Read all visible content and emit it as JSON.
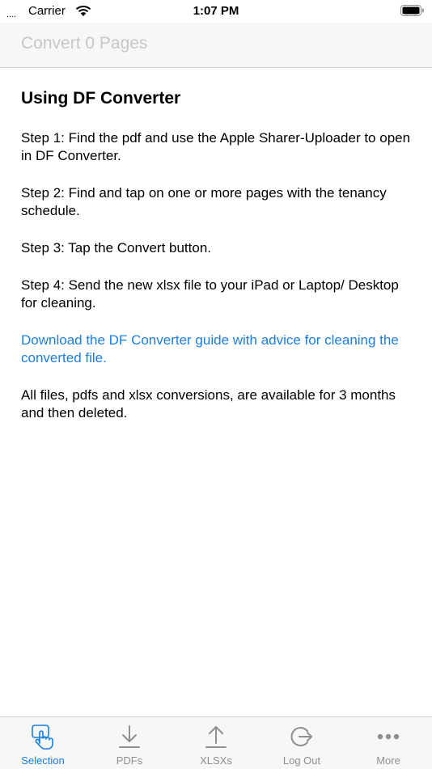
{
  "status_bar": {
    "signal": "....",
    "carrier": "Carrier",
    "time": "1:07 PM"
  },
  "nav": {
    "convert_label": "Convert 0 Pages"
  },
  "content": {
    "heading": "Using DF Converter",
    "steps": [
      "Step 1: Find the pdf and use the Apple Sharer-Uploader to open in DF Converter.",
      "Step 2: Find and tap on one or more pages with the tenancy schedule.",
      "Step 3: Tap the Convert button.",
      "Step 4: Send the new xlsx file to your iPad or Laptop/ Desktop for cleaning."
    ],
    "guide_link": "Download the DF Converter guide with advice for cleaning the converted file.",
    "retention_note": "All files, pdfs and xlsx conversions, are available for 3 months and then deleted."
  },
  "tabs": [
    {
      "label": "Selection",
      "icon": "tap-hand-icon",
      "active": true
    },
    {
      "label": "PDFs",
      "icon": "download-arrow-icon",
      "active": false
    },
    {
      "label": "XLSXs",
      "icon": "upload-arrow-icon",
      "active": false
    },
    {
      "label": "Log Out",
      "icon": "logout-icon",
      "active": false
    },
    {
      "label": "More",
      "icon": "more-dots-icon",
      "active": false
    }
  ],
  "colors": {
    "accent": "#1a7fe0",
    "inactive_tab": "#8e8e93",
    "disabled_nav": "#c7c7c7",
    "bar_background": "#f7f7f7"
  }
}
